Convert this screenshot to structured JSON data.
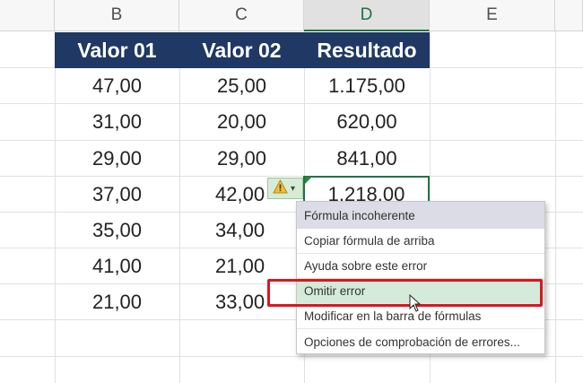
{
  "columns": [
    "B",
    "C",
    "D",
    "E"
  ],
  "table": {
    "headers": [
      "Valor 01",
      "Valor 02",
      "Resultado"
    ],
    "rows": [
      [
        "47,00",
        "25,00",
        "1.175,00"
      ],
      [
        "31,00",
        "20,00",
        "620,00"
      ],
      [
        "29,00",
        "29,00",
        "841,00"
      ],
      [
        "37,00",
        "42,00",
        "1.218,00"
      ],
      [
        "35,00",
        "34,00",
        ""
      ],
      [
        "41,00",
        "21,00",
        ""
      ],
      [
        "21,00",
        "33,00",
        ""
      ]
    ]
  },
  "error_menu": {
    "title": "Fórmula incoherente",
    "items": [
      "Copiar fórmula de arriba",
      "Ayuda sobre este error",
      "Omitir error",
      "Modificar en la barra de fórmulas",
      "Opciones de comprobación de errores..."
    ]
  },
  "colors": {
    "header_bg": "#1f3864",
    "highlight": "#d3ebd8",
    "annotation": "#e0141e",
    "selected": "#217346"
  }
}
